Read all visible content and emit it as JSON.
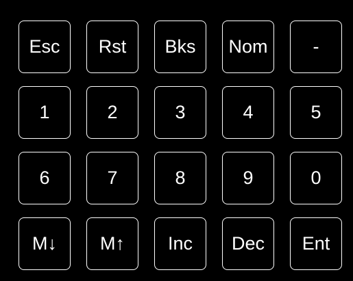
{
  "colors": {
    "background": "#000000",
    "key_border": "#ffffff",
    "key_text": "#ffffff"
  },
  "keypad": {
    "keys": [
      {
        "name": "esc-key",
        "label": "Esc"
      },
      {
        "name": "rst-key",
        "label": "Rst"
      },
      {
        "name": "bks-key",
        "label": "Bks"
      },
      {
        "name": "nom-key",
        "label": "Nom"
      },
      {
        "name": "minus-key",
        "label": "-"
      },
      {
        "name": "digit-1-key",
        "label": "1"
      },
      {
        "name": "digit-2-key",
        "label": "2"
      },
      {
        "name": "digit-3-key",
        "label": "3"
      },
      {
        "name": "digit-4-key",
        "label": "4"
      },
      {
        "name": "digit-5-key",
        "label": "5"
      },
      {
        "name": "digit-6-key",
        "label": "6"
      },
      {
        "name": "digit-7-key",
        "label": "7"
      },
      {
        "name": "digit-8-key",
        "label": "8"
      },
      {
        "name": "digit-9-key",
        "label": "9"
      },
      {
        "name": "digit-0-key",
        "label": "0"
      },
      {
        "name": "m-down-key",
        "label": "M↓"
      },
      {
        "name": "m-up-key",
        "label": "M↑"
      },
      {
        "name": "inc-key",
        "label": "Inc"
      },
      {
        "name": "dec-key",
        "label": "Dec"
      },
      {
        "name": "ent-key",
        "label": "Ent"
      }
    ]
  }
}
